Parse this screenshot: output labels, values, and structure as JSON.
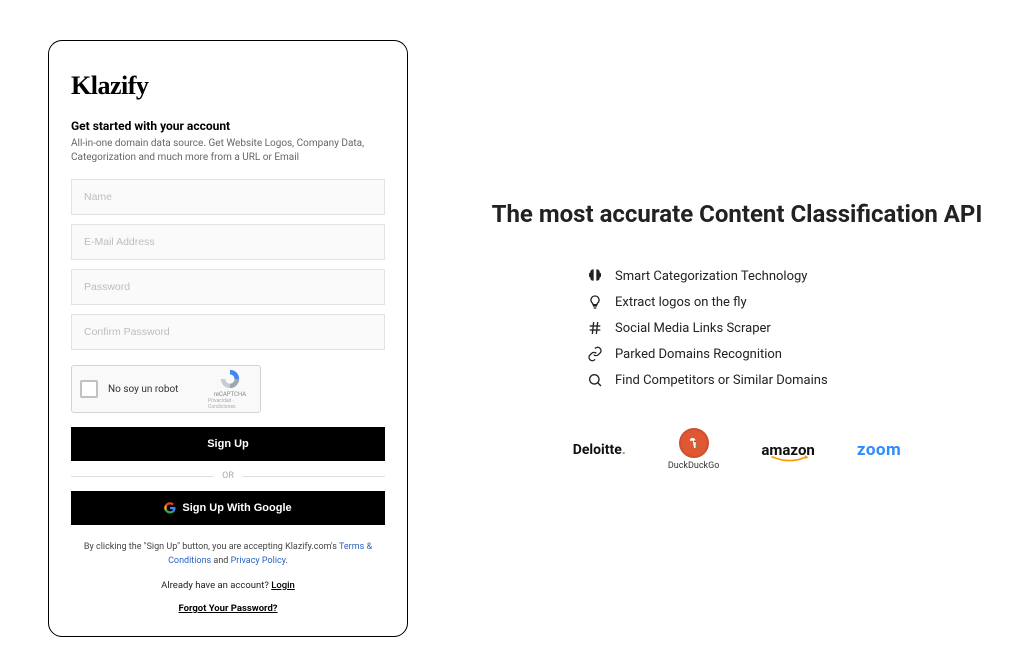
{
  "signup": {
    "logo": "Klazify",
    "heading": "Get started with your account",
    "subheading": "All-in-one domain data source. Get Website Logos, Company Data, Categorization and much more from a URL or Email",
    "name_placeholder": "Name",
    "email_placeholder": "E-Mail Address",
    "password_placeholder": "Password",
    "confirm_placeholder": "Confirm Password",
    "recaptcha_label": "No soy un robot",
    "recaptcha_brand": "reCAPTCHA",
    "recaptcha_sub": "Privacidad - Condiciones",
    "signup_button": "Sign Up",
    "or_text": "OR",
    "google_button": "Sign Up With Google",
    "legal_prefix": "By clicking the \"Sign Up\" button, you are accepting Klazify.com's ",
    "terms_link": "Terms & Conditions",
    "legal_and": " and ",
    "privacy_link": "Privacy Policy",
    "legal_suffix": ".",
    "login_prefix": "Already have an account? ",
    "login_link": "Login",
    "forgot": "Forgot Your Password?"
  },
  "right": {
    "title": "The most accurate Content Classification API",
    "features": [
      "Smart Categorization Technology",
      "Extract logos on the fly",
      "Social Media Links Scraper",
      "Parked Domains Recognition",
      "Find Competitors or Similar Domains"
    ],
    "brands": {
      "deloitte": "Deloitte",
      "duckduckgo": "DuckDuckGo",
      "amazon": "amazon",
      "zoom": "zoom"
    }
  }
}
